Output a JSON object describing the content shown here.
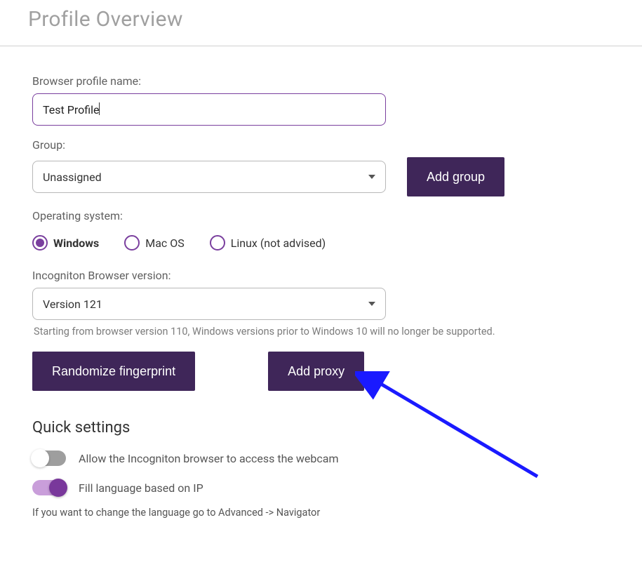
{
  "header": {
    "title": "Profile Overview"
  },
  "profileName": {
    "label": "Browser profile name:",
    "value": "Test Profile"
  },
  "group": {
    "label": "Group:",
    "selected": "Unassigned",
    "addButton": "Add group"
  },
  "os": {
    "label": "Operating system:",
    "options": [
      {
        "label": "Windows",
        "selected": true
      },
      {
        "label": "Mac OS",
        "selected": false
      },
      {
        "label": "Linux (not advised)",
        "selected": false
      }
    ]
  },
  "browserVersion": {
    "label": "Incogniton Browser version:",
    "selected": "Version 121",
    "helper": "Starting from browser version 110, Windows versions prior to Windows 10 will no longer be supported."
  },
  "buttons": {
    "randomize": "Randomize fingerprint",
    "addProxy": "Add proxy"
  },
  "quickSettings": {
    "title": "Quick settings",
    "webcam": {
      "label": "Allow the Incogniton browser to access the webcam",
      "on": false
    },
    "language": {
      "label": "Fill language based on IP",
      "on": true
    },
    "note": "If you want to change the language go to Advanced -> Navigator"
  }
}
